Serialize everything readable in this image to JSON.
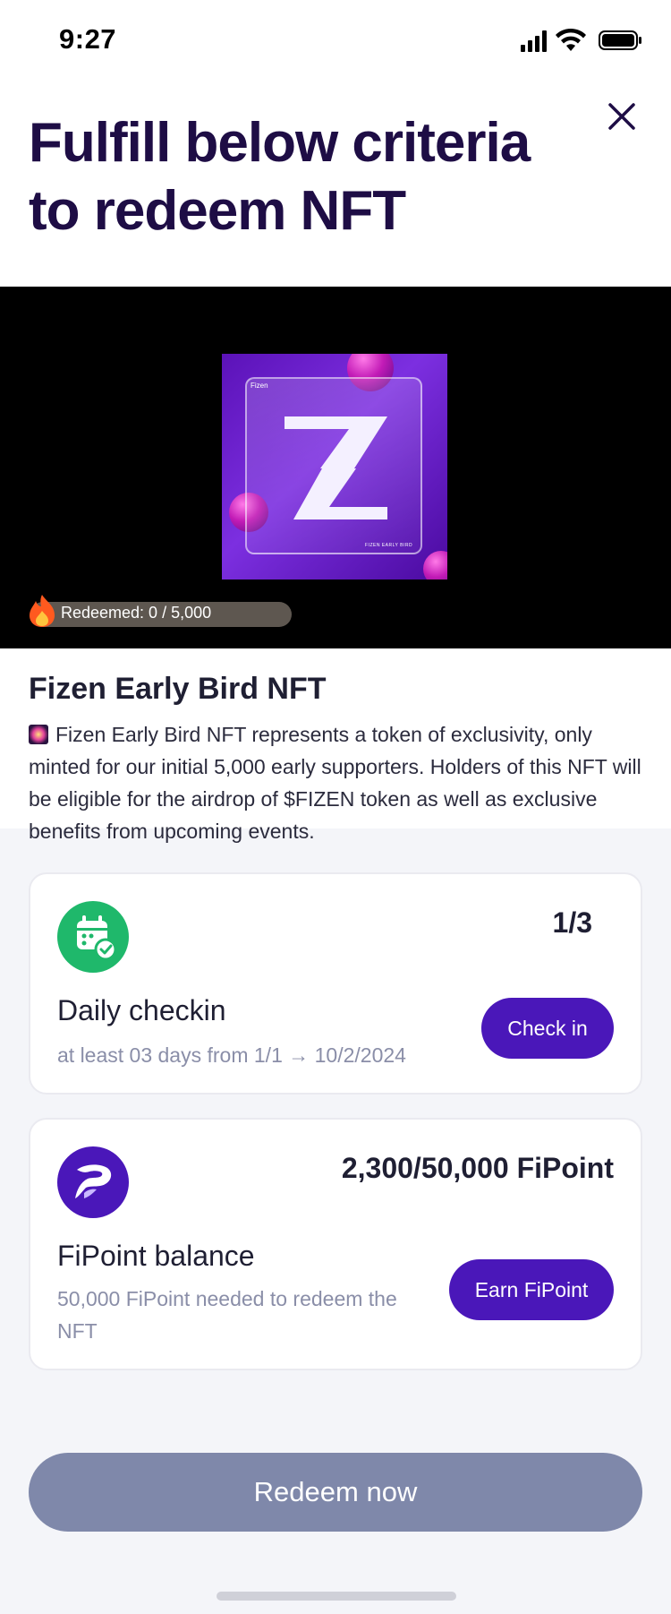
{
  "status_bar": {
    "time": "9:27"
  },
  "header": {
    "title": "Fulfill below criteria to redeem NFT"
  },
  "media": {
    "nft_brand_label": "Fizen",
    "nft_footer_label": "FIZEN EARLY BIRD",
    "redeemed_text": "Redeemed: 0 / 5,000",
    "redeemed_count": 0,
    "redeemed_total": 5000
  },
  "nft": {
    "name": "Fizen Early Bird NFT",
    "description": "Fizen Early Bird NFT represents a token of exclusivity, only minted for our initial 5,000 early supporters. Holders of this NFT will be eligible for the airdrop of $FIZEN token as well as exclusive benefits from upcoming events."
  },
  "criteria": [
    {
      "icon": "calendar-check-icon",
      "progress": "1/3",
      "title": "Daily checkin",
      "subtitle": "at least 03 days from 1/1 → 10/2/2024",
      "button": "Check in",
      "color": "#1fb86b"
    },
    {
      "icon": "fipoint-logo-icon",
      "progress": "2,300/50,000 FiPoint",
      "title": "FiPoint balance",
      "subtitle": "50,000 FiPoint needed to redeem the NFT",
      "button": "Earn FiPoint",
      "color": "#4a17b9"
    }
  ],
  "footer": {
    "redeem_label": "Redeem now"
  },
  "colors": {
    "accent": "#4a17b9",
    "title": "#1e0d45",
    "disabled": "#7f88aa",
    "muted_text": "#8a8ea8"
  }
}
